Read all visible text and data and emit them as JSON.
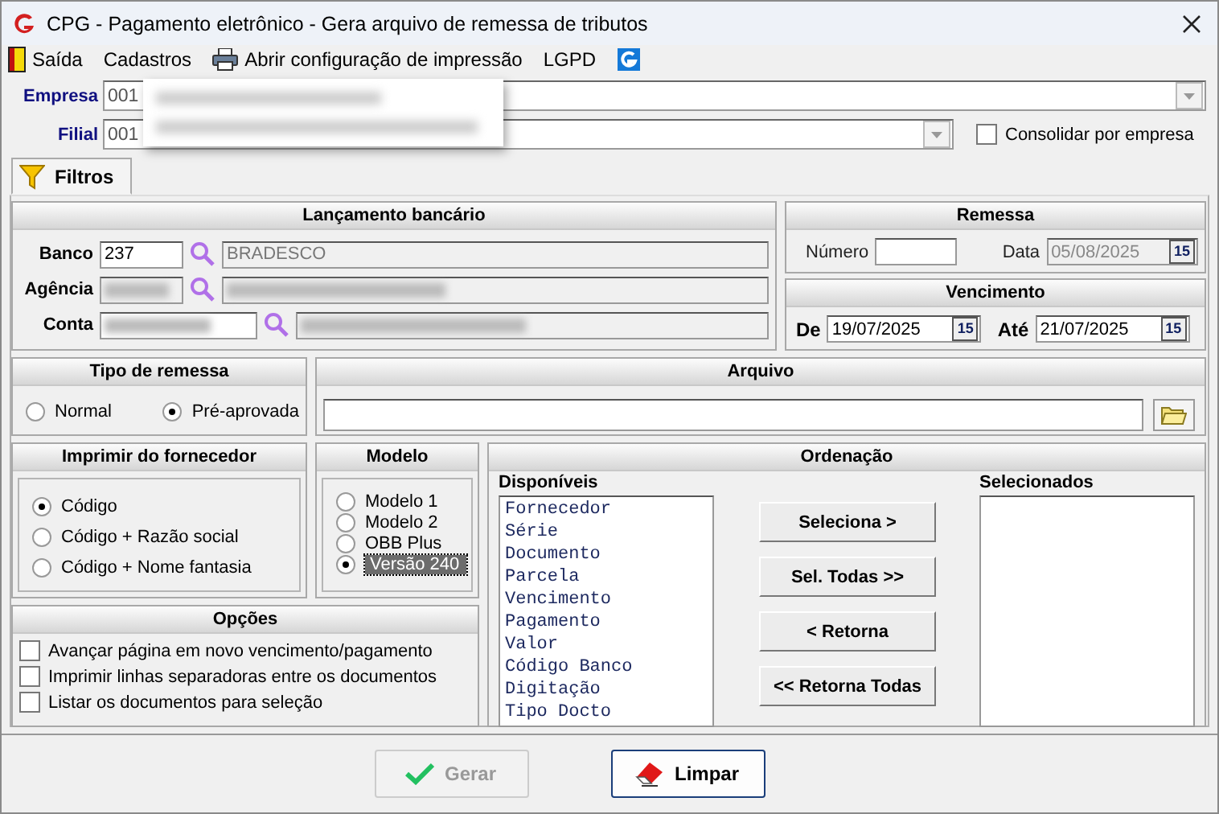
{
  "window": {
    "title": "CPG - Pagamento eletrônico - Gera arquivo de remessa de tributos"
  },
  "menu": [
    {
      "label": "Saída",
      "kind": "door"
    },
    {
      "label": "Cadastros",
      "kind": "plain"
    },
    {
      "label": "Abrir configuração de impressão",
      "kind": "printer"
    },
    {
      "label": "LGPD",
      "kind": "plain"
    },
    {
      "kind": "logo"
    }
  ],
  "empresa": {
    "label": "Empresa",
    "value": "001"
  },
  "filial": {
    "label": "Filial",
    "value": "001"
  },
  "consolidar": {
    "label": "Consolidar por empresa",
    "checked": false
  },
  "tabs": [
    {
      "label": "Filtros",
      "selected": true
    }
  ],
  "lancamento": {
    "title": "Lançamento bancário",
    "banco": {
      "label": "Banco",
      "code": "237",
      "name": "BRADESCO"
    },
    "agencia": {
      "label": "Agência"
    },
    "conta": {
      "label": "Conta"
    }
  },
  "remessa": {
    "title": "Remessa",
    "numero_label": "Número",
    "data_label": "Data",
    "data": {
      "value": "05/08/2025",
      "button": "15",
      "disabled": true
    }
  },
  "vencimento": {
    "title": "Vencimento",
    "de": {
      "label": "De",
      "value": "19/07/2025",
      "button": "15"
    },
    "ate": {
      "label": "Até",
      "value": "21/07/2025",
      "button": "15"
    }
  },
  "tipo_remessa": {
    "title": "Tipo de remessa",
    "options": [
      {
        "label": "Normal",
        "selected": false
      },
      {
        "label": "Pré-aprovada",
        "selected": true
      }
    ]
  },
  "arquivo": {
    "title": "Arquivo"
  },
  "imprimir": {
    "title": "Imprimir do fornecedor",
    "options": [
      {
        "label": "Código",
        "selected": true
      },
      {
        "label": "Código + Razão social",
        "selected": false
      },
      {
        "label": "Código + Nome fantasia",
        "selected": false
      }
    ]
  },
  "modelo": {
    "title": "Modelo",
    "options": [
      {
        "label": "Modelo 1",
        "selected": false
      },
      {
        "label": "Modelo 2",
        "selected": false
      },
      {
        "label": "OBB Plus",
        "selected": false
      },
      {
        "label": "Versão 240",
        "selected": true
      }
    ]
  },
  "opcoes": {
    "title": "Opções",
    "items": [
      {
        "label": "Avançar página em novo vencimento/pagamento",
        "checked": false
      },
      {
        "label": "Imprimir linhas separadoras entre os documentos",
        "checked": false
      },
      {
        "label": "Listar os documentos para seleção",
        "checked": false
      }
    ]
  },
  "ordenacao": {
    "title": "Ordenação",
    "available_label": "Disponíveis",
    "available": [
      "Fornecedor",
      "Série",
      "Documento",
      "Parcela",
      "Vencimento",
      "Pagamento",
      "Valor",
      "Código Banco",
      "Digitação",
      "Tipo Docto"
    ],
    "selected_label": "Selecionados",
    "buttons": [
      "Seleciona >",
      "Sel. Todas >>",
      "< Retorna",
      "<< Retorna Todas"
    ]
  },
  "actions": [
    {
      "label": "Gerar",
      "kind": "check",
      "disabled": true
    },
    {
      "label": "Limpar",
      "kind": "eraser",
      "disabled": false
    }
  ]
}
